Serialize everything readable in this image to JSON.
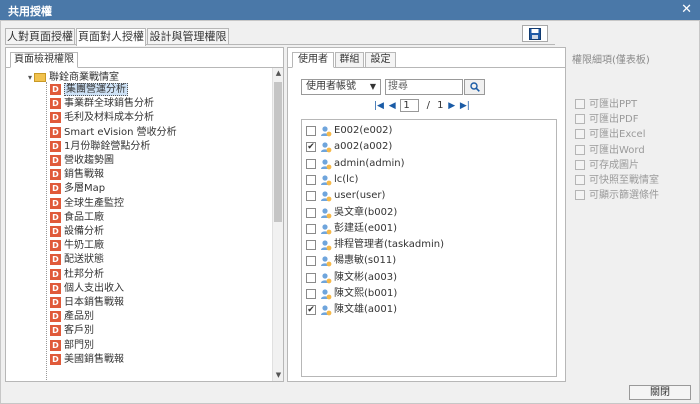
{
  "window": {
    "title": "共用授權"
  },
  "top_tabs": [
    {
      "label": "人對頁面授權"
    },
    {
      "label": "頁面對人授權"
    },
    {
      "label": "設計與管理權限"
    }
  ],
  "left_panel": {
    "tab_label": "頁面檢視權限",
    "root": "聯銓商業戰情室",
    "items": [
      "集團營運分析",
      "事業群全球銷售分析",
      "毛利及材料成本分析",
      "Smart eVision 營收分析",
      "1月份聯銓營點分析",
      "營收趨勢圖",
      "銷售戰報",
      "多層Map",
      "全球生產監控",
      "食品工廠",
      "設備分析",
      "牛奶工廠",
      "配送狀態",
      "杜邦分析",
      "個人支出收入",
      "日本銷售戰報",
      "產品別",
      "客戶別",
      "部門別",
      "美國銷售戰報"
    ],
    "item_icon": "D"
  },
  "mid_panel": {
    "tabs": [
      {
        "label": "使用者"
      },
      {
        "label": "群組"
      },
      {
        "label": "設定"
      }
    ],
    "select_value": "使用者帳號",
    "search_placeholder": "搜尋",
    "pager": {
      "current": "1",
      "separator": "/",
      "total": "1"
    },
    "users": [
      {
        "label": "E002(e002)",
        "checked": false
      },
      {
        "label": "a002(a002)",
        "checked": true
      },
      {
        "label": "admin(admin)",
        "checked": false
      },
      {
        "label": "lc(lc)",
        "checked": false
      },
      {
        "label": "user(user)",
        "checked": false
      },
      {
        "label": "吳文章(b002)",
        "checked": false
      },
      {
        "label": "彭建廷(e001)",
        "checked": false
      },
      {
        "label": "排程管理者(taskadmin)",
        "checked": false
      },
      {
        "label": "楊惠敏(s011)",
        "checked": false
      },
      {
        "label": "陳文彬(a003)",
        "checked": false
      },
      {
        "label": "陳文熙(b001)",
        "checked": false
      },
      {
        "label": "陳文雄(a001)",
        "checked": true
      }
    ]
  },
  "right_panel": {
    "title": "權限細項(僅表板)",
    "items": [
      "可匯出PPT",
      "可匯出PDF",
      "可匯出Excel",
      "可匯出Word",
      "可存成圖片",
      "可快照至戰情室",
      "可顯示篩選條件"
    ]
  },
  "footer": {
    "close_label": "關閉"
  },
  "colors": {
    "titlebar": "#4a78a8",
    "d_icon": "#e05a3a",
    "selected_row": "#cfe3f7",
    "pager_arrows": "#1a5ba6"
  }
}
